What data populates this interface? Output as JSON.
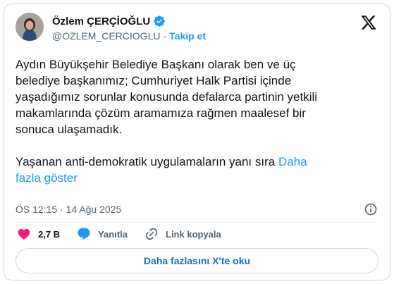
{
  "author": {
    "display_name": "Özlem ÇERÇİOĞLU",
    "handle": "@OZLEM_CERCIOGLU",
    "follow_label": "Takip et",
    "separator": "·",
    "verified": true
  },
  "icons": {
    "brand": "x-logo-icon",
    "verified": "verified-badge-icon",
    "info": "info-icon",
    "like": "heart-icon",
    "reply": "reply-bubble-icon",
    "copy_link": "link-icon"
  },
  "tweet": {
    "text": "Aydın Büyükşehir Belediye Başkanı olarak ben ve üç\nbelediye başkanımız; Cumhuriyet Halk Partisi içinde\nyaşadığımız sorunlar konusunda defalarca partinin yetkili\nmakamlarında çözüm aramamıza rağmen maalesef bir\nsonuca ulaşamadık.\n\nYaşanan anti-demokratik uygulamaların yanı sıra ",
    "show_more": "Daha\nfazla göster",
    "timestamp": "ÖS 12:15 · 14 Ağu 2025"
  },
  "actions": {
    "likes": "2,7 B",
    "reply": "Yanıtla",
    "copy_link": "Link kopyala"
  },
  "read_more_button": "Daha fazlasını X'te oku",
  "colors": {
    "accent": "#1d9bf0",
    "like": "#f91880",
    "text": "#0f1419",
    "muted": "#536471",
    "border": "#cfd9de"
  }
}
